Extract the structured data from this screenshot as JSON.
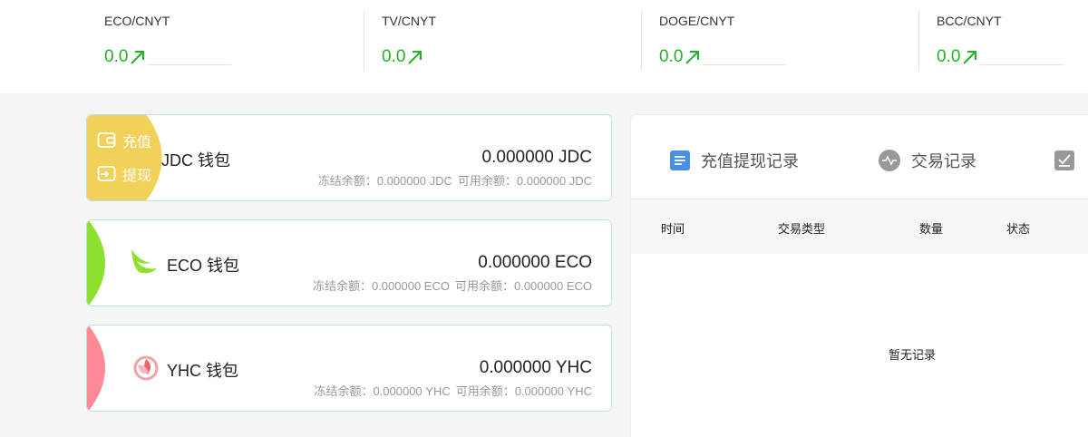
{
  "ticker": [
    {
      "pair": "ECO/CNYT",
      "price": "0.0"
    },
    {
      "pair": "TV/CNYT",
      "price": "0.0"
    },
    {
      "pair": "DOGE/CNYT",
      "price": "0.0"
    },
    {
      "pair": "BCC/CNYT",
      "price": "0.0"
    }
  ],
  "colors": {
    "up": "#20b22b",
    "jdc": "#f2d15a",
    "eco": "#8ee02e",
    "yhc": "#ff8a95"
  },
  "wallets": [
    {
      "title": "JDC 钱包",
      "balance": "0.000000 JDC",
      "frozen": "冻结余额：0.000000 JDC",
      "available": "可用余额：0.000000 JDC",
      "actions": {
        "recharge": "充值",
        "withdraw": "提现"
      }
    },
    {
      "title": "ECO 钱包",
      "balance": "0.000000 ECO",
      "frozen": "冻结余额：0.000000 ECO",
      "available": "可用余额：0.000000 ECO"
    },
    {
      "title": "YHC 钱包",
      "balance": "0.000000 YHC",
      "frozen": "冻结余额：0.000000 YHC",
      "available": "可用余额：0.000000 YHC"
    }
  ],
  "records": {
    "tabs": [
      "充值提现记录",
      "交易记录"
    ],
    "columns": [
      "时间",
      "交易类型",
      "数量",
      "状态"
    ],
    "empty": "暂无记录"
  }
}
